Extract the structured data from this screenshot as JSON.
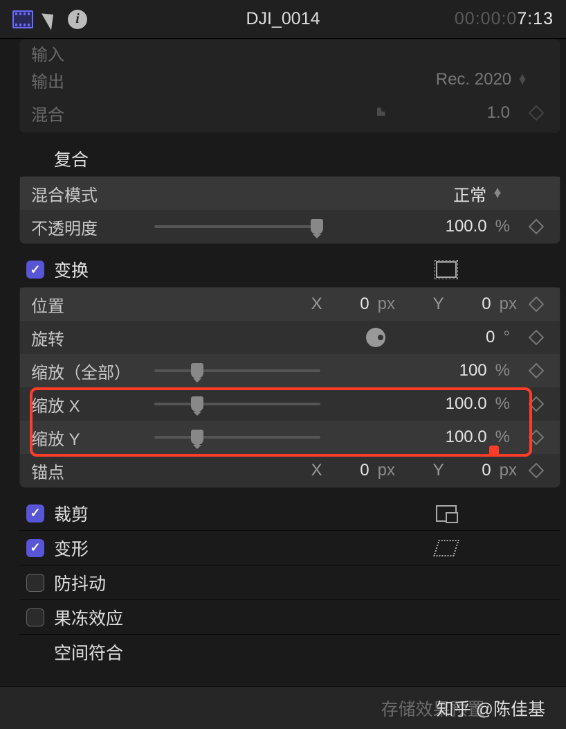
{
  "header": {
    "clip_title": "DJI_0014",
    "timecode_dim": "00:00:0",
    "timecode_bright": "7:13"
  },
  "color_card": {
    "output_label": "输出",
    "output_value": "Rec. 2020",
    "blend_label": "混合",
    "blend_value": "1.0",
    "hidden_top_label": "输入"
  },
  "composite": {
    "title": "复合",
    "blend_mode_label": "混合模式",
    "blend_mode_value": "正常",
    "opacity_label": "不透明度",
    "opacity_value": "100.0",
    "opacity_unit": "%"
  },
  "transform": {
    "title": "变换",
    "position_label": "位置",
    "pos_x_axis": "X",
    "pos_x_val": "0",
    "pos_x_unit": "px",
    "pos_y_axis": "Y",
    "pos_y_val": "0",
    "pos_y_unit": "px",
    "rotation_label": "旋转",
    "rotation_val": "0",
    "rotation_unit": "°",
    "scale_all_label": "缩放（全部）",
    "scale_all_val": "100",
    "scale_all_unit": "%",
    "scale_x_label": "缩放 X",
    "scale_x_val": "100.0",
    "scale_x_unit": "%",
    "scale_y_label": "缩放 Y",
    "scale_y_val": "100.0",
    "scale_y_unit": "%",
    "anchor_label": "锚点",
    "anchor_x_axis": "X",
    "anchor_x_val": "0",
    "anchor_x_unit": "px",
    "anchor_y_axis": "Y",
    "anchor_y_val": "0",
    "anchor_y_unit": "px"
  },
  "crop": {
    "title": "裁剪"
  },
  "distort": {
    "title": "变形"
  },
  "stabilize": {
    "title": "防抖动"
  },
  "rolling": {
    "title": "果冻效应"
  },
  "spatial": {
    "title": "空间符合"
  },
  "footer": {
    "save_preset": "存储效果预置",
    "watermark": "知乎 @陈佳基"
  }
}
